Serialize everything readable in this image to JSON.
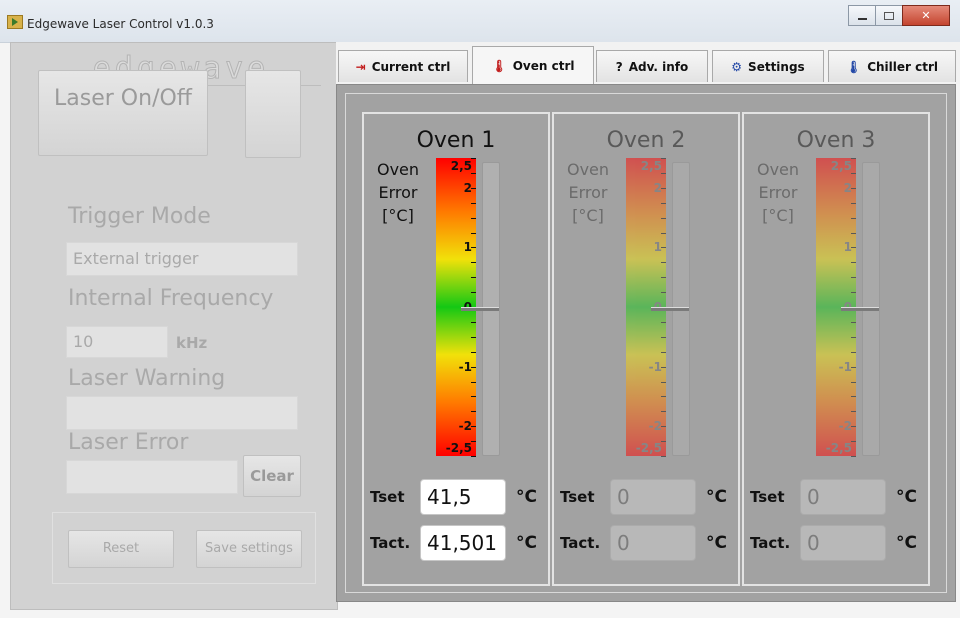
{
  "window": {
    "title": "Edgewave Laser Control v1.0.3"
  },
  "left_panel": {
    "logo": "edgewave",
    "laser_button": "Laser On/Off",
    "trigger_mode_label": "Trigger Mode",
    "trigger_mode_value": "External trigger",
    "internal_frequency_label": "Internal Frequency",
    "internal_frequency_value": "10",
    "frequency_unit": "kHz",
    "laser_warning_label": "Laser Warning",
    "laser_warning_value": "",
    "laser_error_label": "Laser Error",
    "laser_error_value": "",
    "clear_button": "Clear",
    "reset_button": "Reset",
    "save_settings_button": "Save settings"
  },
  "tabs": [
    {
      "label": "Current ctrl",
      "icon": "current-icon",
      "active": false
    },
    {
      "label": "Oven ctrl",
      "icon": "thermometer-icon",
      "active": true
    },
    {
      "label": "Adv. info",
      "icon": "question-icon",
      "active": false
    },
    {
      "label": "Settings",
      "icon": "settings-icon",
      "active": false
    },
    {
      "label": "Chiller ctrl",
      "icon": "thermometer-icon",
      "active": false
    }
  ],
  "ovens": [
    {
      "title": "Oven 1",
      "error_label": "Oven Error [°C]",
      "scale_ticks": [
        "2,5",
        "2",
        "1",
        "0",
        "-1",
        "-2",
        "-2,5"
      ],
      "error_value": 0,
      "tset_label": "Tset",
      "tset": "41,5",
      "tact_label": "Tact.",
      "tact": "41,501",
      "unit": "°C",
      "enabled": true
    },
    {
      "title": "Oven 2",
      "error_label": "Oven Error [°C]",
      "scale_ticks": [
        "2,5",
        "2",
        "1",
        "0",
        "-1",
        "-2",
        "-2,5"
      ],
      "error_value": 0,
      "tset_label": "Tset",
      "tset": "0",
      "tact_label": "Tact.",
      "tact": "0",
      "unit": "°C",
      "enabled": false
    },
    {
      "title": "Oven 3",
      "error_label": "Oven Error [°C]",
      "scale_ticks": [
        "2,5",
        "2",
        "1",
        "0",
        "-1",
        "-2",
        "-2,5"
      ],
      "error_value": 0,
      "tset_label": "Tset",
      "tset": "0",
      "tact_label": "Tact.",
      "tact": "0",
      "unit": "°C",
      "enabled": false
    }
  ]
}
